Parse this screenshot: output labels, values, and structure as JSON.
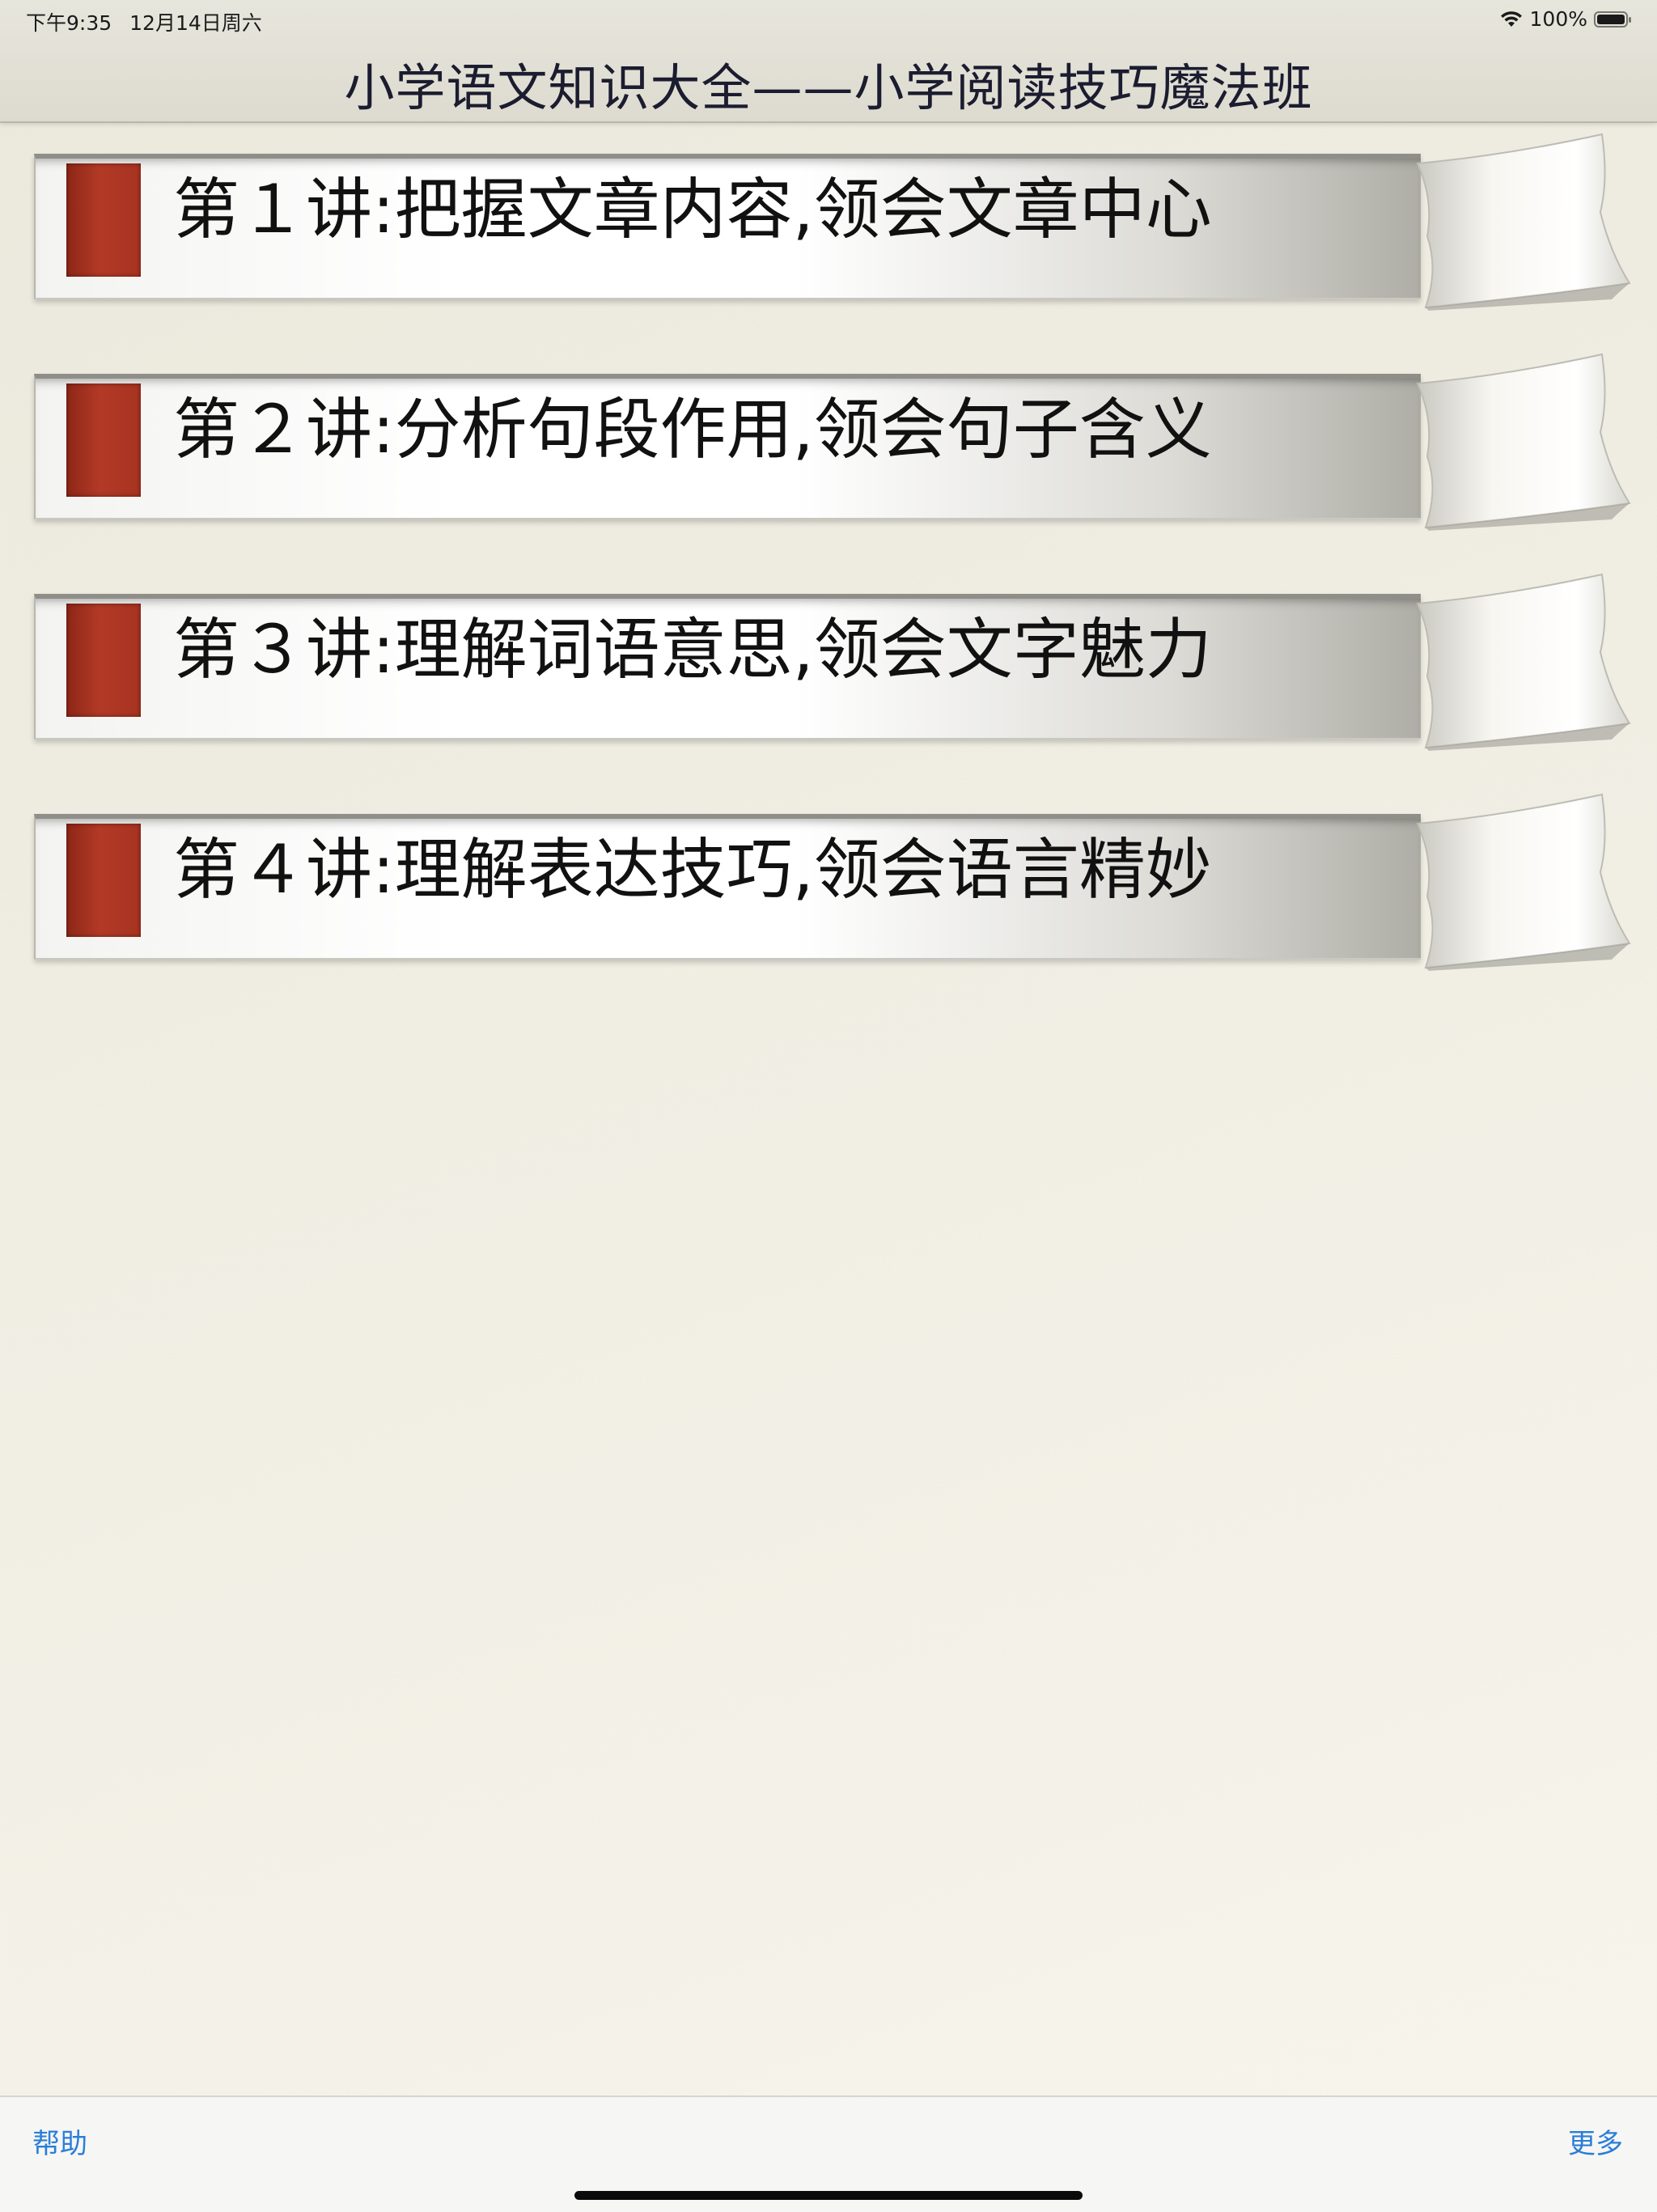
{
  "status_bar": {
    "time": "下午9:35",
    "date": "12月14日周六",
    "battery_text": "100%",
    "wifi_icon": "wifi-icon",
    "battery_icon": "battery-full-icon"
  },
  "header": {
    "title": "小学语文知识大全——小学阅读技巧魔法班"
  },
  "lessons": [
    {
      "label": "第１讲:把握文章内容,领会文章中心"
    },
    {
      "label": "第２讲:分析句段作用,领会句子含义"
    },
    {
      "label": "第３讲:理解词语意思,领会文字魅力"
    },
    {
      "label": "第４讲:理解表达技巧,领会语言精妙"
    }
  ],
  "toolbar": {
    "help_label": "帮助",
    "more_label": "更多"
  },
  "colors": {
    "accent": "#2a7ed9",
    "bookmark": "#b23a26",
    "background": "#efede3"
  }
}
